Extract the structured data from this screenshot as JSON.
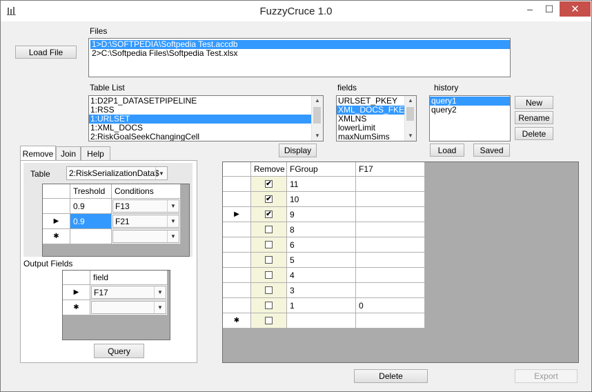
{
  "window": {
    "title": "FuzzyCruce 1.0",
    "controls": {
      "minimize": "–",
      "maximize": "☐",
      "close": "✕"
    }
  },
  "files": {
    "label": "Files",
    "load_button": "Load File",
    "items": [
      {
        "text": "1>D:\\SOFTPEDIA\\Softpedia Test.accdb",
        "selected": true
      },
      {
        "text": "2>C:\\Softpedia Files\\Softpedia Test.xlsx",
        "selected": false
      }
    ]
  },
  "table_list": {
    "label": "Table List",
    "items": [
      {
        "text": "1:D2P1_DATASETPIPELINE",
        "selected": false
      },
      {
        "text": "1:RSS",
        "selected": false
      },
      {
        "text": "1:URLSET",
        "selected": true
      },
      {
        "text": "1:XML_DOCS",
        "selected": false
      },
      {
        "text": "2:RiskGoalSeekChangingCell",
        "selected": false
      }
    ]
  },
  "fields": {
    "label": "fields",
    "items": [
      {
        "text": "URLSET_PKEY",
        "selected": false
      },
      {
        "text": "XML_DOCS_FKEY",
        "selected": true
      },
      {
        "text": "XMLNS",
        "selected": false
      },
      {
        "text": "lowerLimit",
        "selected": false
      },
      {
        "text": "maxNumSims",
        "selected": false
      }
    ]
  },
  "display_button": "Display",
  "history": {
    "label": "history",
    "items": [
      {
        "text": "query1",
        "selected": true
      },
      {
        "text": "query2",
        "selected": false
      }
    ],
    "new_button": "New",
    "rename_button": "Rename",
    "delete_button": "Delete",
    "load_button": "Load",
    "saved_button": "Saved"
  },
  "tabs": [
    {
      "label": "Remove",
      "active": true
    },
    {
      "label": "Join",
      "active": false
    },
    {
      "label": "Help",
      "active": false
    }
  ],
  "remove_panel": {
    "table_label": "Table",
    "table_value": "2:RiskSerializationData$",
    "conditions_grid": {
      "headers": [
        "Treshold",
        "Conditions"
      ],
      "rows": [
        {
          "marker": "",
          "treshold": "0.9",
          "condition": "F13",
          "selected": false
        },
        {
          "marker": "▶",
          "treshold": "0.9",
          "condition": "F21",
          "selected": true
        },
        {
          "marker": "✱",
          "treshold": "",
          "condition": "",
          "selected": false
        }
      ]
    },
    "output_label": "Output Fields",
    "output_grid": {
      "headers": [
        "field"
      ],
      "rows": [
        {
          "marker": "▶",
          "field": "F17"
        },
        {
          "marker": "✱",
          "field": ""
        }
      ]
    },
    "query_button": "Query"
  },
  "results_grid": {
    "headers": [
      "Remove",
      "FGroup",
      "F17"
    ],
    "rows": [
      {
        "marker": "",
        "checked": true,
        "fgroup": "11",
        "f17": ""
      },
      {
        "marker": "",
        "checked": true,
        "fgroup": "10",
        "f17": ""
      },
      {
        "marker": "▶",
        "checked": true,
        "fgroup": "9",
        "f17": ""
      },
      {
        "marker": "",
        "checked": false,
        "fgroup": "8",
        "f17": ""
      },
      {
        "marker": "",
        "checked": false,
        "fgroup": "6",
        "f17": ""
      },
      {
        "marker": "",
        "checked": false,
        "fgroup": "5",
        "f17": ""
      },
      {
        "marker": "",
        "checked": false,
        "fgroup": "4",
        "f17": ""
      },
      {
        "marker": "",
        "checked": false,
        "fgroup": "3",
        "f17": ""
      },
      {
        "marker": "",
        "checked": false,
        "fgroup": "1",
        "f17": "0"
      },
      {
        "marker": "✱",
        "checked": false,
        "fgroup": "",
        "f17": ""
      }
    ]
  },
  "bottom": {
    "delete_button": "Delete",
    "export_button": "Export"
  },
  "colors": {
    "selection": "#3399ff",
    "grid_bg": "#ababab",
    "checkbox_col": "#f5f5dc",
    "close": "#c7504a"
  }
}
